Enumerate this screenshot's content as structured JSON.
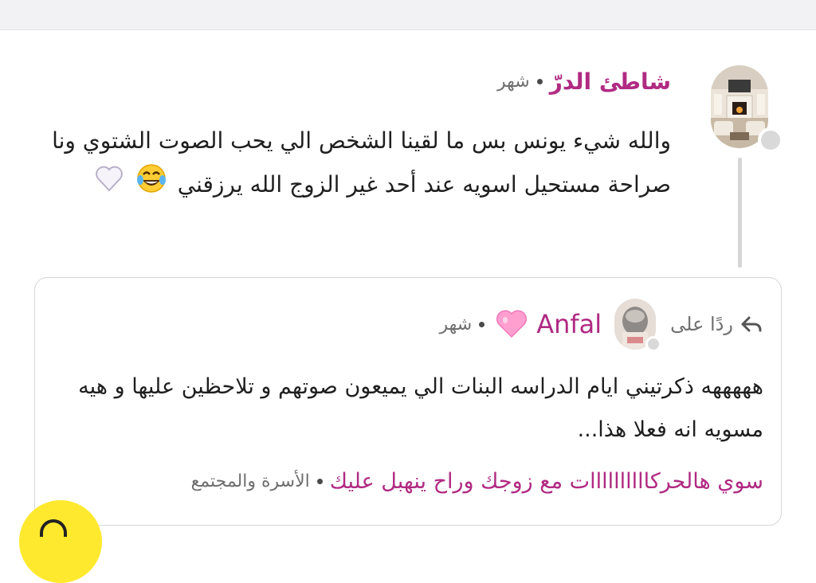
{
  "main_comment": {
    "author": "شاطئ الدرّ",
    "time": "شهر",
    "body": "والله شيء يونس بس ما لقينا الشخص الي يحب الصوت الشتوي ونا صراحة مستحيل اسويه عند أحد غير الزوج الله يرزقني",
    "emojis": [
      "face-with-tears-of-joy",
      "white-heart"
    ]
  },
  "reply": {
    "reply_to_label": "ردًا على",
    "author": "Anfal",
    "author_badge": "pink-heart",
    "time": "شهر",
    "body": "هههههه ذكرتيني ايام الدراسه البنات الي يميعون صوتهم و تلاحظين عليها و هيه مسويه انه فعلا هذا...",
    "topic_link": "سوي هالحركاااااااااات مع زوجك وراح ينهبل عليك",
    "category": "الأسرة والمجتمع"
  },
  "colors": {
    "accent": "#b02a82",
    "muted_text": "#6f6f6f",
    "body_text": "#1f1f1f",
    "border": "#d7d7d7",
    "floating_button": "#ffe92e"
  }
}
